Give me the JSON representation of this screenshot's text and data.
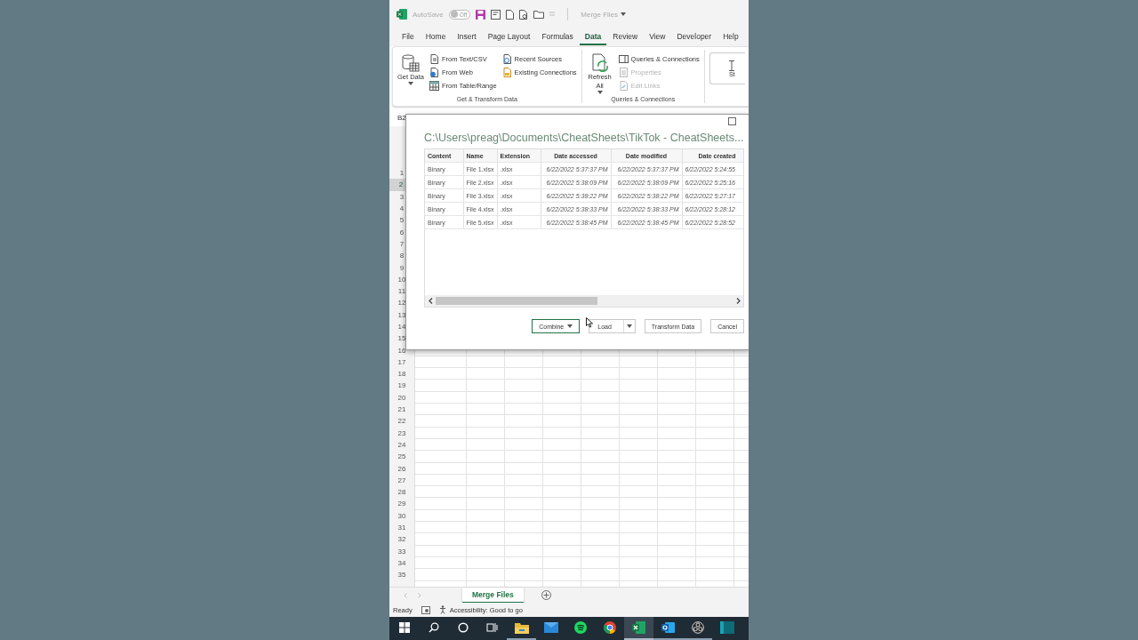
{
  "title_bar": {
    "autosave_label": "AutoSave",
    "autosave_toggle": {
      "label": "Off",
      "on": false
    },
    "document_title": "Merge Files"
  },
  "ribbon_tabs": [
    {
      "label": "File",
      "selected": false
    },
    {
      "label": "Home",
      "selected": false
    },
    {
      "label": "Insert",
      "selected": false
    },
    {
      "label": "Page Layout",
      "selected": false
    },
    {
      "label": "Formulas",
      "selected": false
    },
    {
      "label": "Data",
      "selected": true
    },
    {
      "label": "Review",
      "selected": false
    },
    {
      "label": "View",
      "selected": false
    },
    {
      "label": "Developer",
      "selected": false
    },
    {
      "label": "Help",
      "selected": false
    }
  ],
  "ribbon": {
    "groups": [
      {
        "label": "Get & Transform Data",
        "large_button": {
          "label": "Get Data",
          "kind": "database"
        },
        "columns": [
          [
            {
              "label": "From Text/CSV",
              "kind": "text-file",
              "disabled": false
            },
            {
              "label": "From Web",
              "kind": "web-file",
              "disabled": false
            },
            {
              "label": "From Table/Range",
              "kind": "table",
              "disabled": false
            }
          ],
          [
            {
              "label": "Recent Sources",
              "kind": "recent-file",
              "disabled": false
            },
            {
              "label": "Existing Connections",
              "kind": "folder-file",
              "disabled": false
            }
          ]
        ]
      },
      {
        "label": "Queries & Connections",
        "large_button": {
          "label": "Refresh All",
          "kind": "refresh"
        },
        "columns": [
          [
            {
              "label": "Queries & Connections",
              "kind": "panel",
              "disabled": false
            },
            {
              "label": "Properties",
              "kind": "properties",
              "disabled": true
            },
            {
              "label": "Edit Links",
              "kind": "links",
              "disabled": true
            }
          ]
        ]
      }
    ],
    "cut_button": {
      "label": "St"
    }
  },
  "name_box": "B2",
  "row_headers": [
    {
      "label": "1",
      "selected": false
    },
    {
      "label": "2",
      "selected": true
    },
    {
      "label": "3",
      "selected": false
    },
    {
      "label": "4",
      "selected": false
    },
    {
      "label": "5",
      "selected": false
    },
    {
      "label": "6",
      "selected": false
    },
    {
      "label": "7",
      "selected": false
    },
    {
      "label": "8",
      "selected": false
    },
    {
      "label": "9",
      "selected": false
    },
    {
      "label": "10",
      "selected": false
    },
    {
      "label": "11",
      "selected": false
    },
    {
      "label": "12",
      "selected": false
    },
    {
      "label": "13",
      "selected": false
    },
    {
      "label": "14",
      "selected": false
    },
    {
      "label": "15",
      "selected": false
    },
    {
      "label": "16",
      "selected": false
    },
    {
      "label": "17",
      "selected": false
    },
    {
      "label": "18",
      "selected": false
    },
    {
      "label": "19",
      "selected": false
    },
    {
      "label": "20",
      "selected": false
    },
    {
      "label": "21",
      "selected": false
    },
    {
      "label": "22",
      "selected": false
    },
    {
      "label": "23",
      "selected": false
    },
    {
      "label": "24",
      "selected": false
    },
    {
      "label": "25",
      "selected": false
    },
    {
      "label": "26",
      "selected": false
    },
    {
      "label": "27",
      "selected": false
    },
    {
      "label": "28",
      "selected": false
    },
    {
      "label": "29",
      "selected": false
    },
    {
      "label": "30",
      "selected": false
    },
    {
      "label": "31",
      "selected": false
    },
    {
      "label": "32",
      "selected": false
    },
    {
      "label": "33",
      "selected": false
    },
    {
      "label": "34",
      "selected": false
    },
    {
      "label": "35",
      "selected": false
    }
  ],
  "dialog": {
    "title": "C:\\Users\\preag\\Documents\\CheatSheets\\TikTok - CheatSheets...",
    "columns": [
      "Content",
      "Name",
      "Extension",
      "Date accessed",
      "Date modified",
      "Date created"
    ],
    "rows": [
      [
        "Binary",
        "File 1.xlsx",
        ".xlsx",
        "6/22/2022 5:37:37 PM",
        "6/22/2022 5:37:37 PM",
        "6/22/2022 5:24:55"
      ],
      [
        "Binary",
        "File 2.xlsx",
        ".xlsx",
        "6/22/2022 5:38:09 PM",
        "6/22/2022 5:38:09 PM",
        "6/22/2022 5:25:16"
      ],
      [
        "Binary",
        "File 3.xlsx",
        ".xlsx",
        "6/22/2022 5:38:22 PM",
        "6/22/2022 5:38:22 PM",
        "6/22/2022 5:27:17"
      ],
      [
        "Binary",
        "File 4.xlsx",
        ".xlsx",
        "6/22/2022 5:38:33 PM",
        "6/22/2022 5:38:33 PM",
        "6/22/2022 5:28:12"
      ],
      [
        "Binary",
        "File 5.xlsx",
        ".xlsx",
        "6/22/2022 5:38:45 PM",
        "6/22/2022 5:38:45 PM",
        "6/22/2022 5:28:52"
      ]
    ],
    "buttons": [
      {
        "label": "Combine",
        "kind": "dropdown",
        "default": true
      },
      {
        "label": "Load",
        "kind": "split",
        "default": false
      },
      {
        "label": "Transform Data",
        "kind": "plain",
        "default": false
      },
      {
        "label": "Cancel",
        "kind": "plain",
        "default": false
      }
    ]
  },
  "sheet_tabs": [
    {
      "label": "Merge Files",
      "selected": true
    }
  ],
  "status_bar": {
    "mode": "Ready",
    "accessibility": "Accessibility: Good to go"
  },
  "taskbar": [
    {
      "kind": "start",
      "running": false,
      "active": false
    },
    {
      "kind": "search",
      "running": false,
      "active": false
    },
    {
      "kind": "cortana",
      "running": false,
      "active": false
    },
    {
      "kind": "task-view",
      "running": false,
      "active": false
    },
    {
      "kind": "explorer",
      "running": true,
      "active": false
    },
    {
      "kind": "mail",
      "running": false,
      "active": false
    },
    {
      "kind": "spotify",
      "running": false,
      "active": false
    },
    {
      "kind": "chrome",
      "running": false,
      "active": false
    },
    {
      "kind": "excel",
      "running": true,
      "active": true
    },
    {
      "kind": "outlook",
      "running": true,
      "active": false
    },
    {
      "kind": "obs",
      "running": true,
      "active": false
    },
    {
      "kind": "app",
      "running": false,
      "active": false
    }
  ]
}
